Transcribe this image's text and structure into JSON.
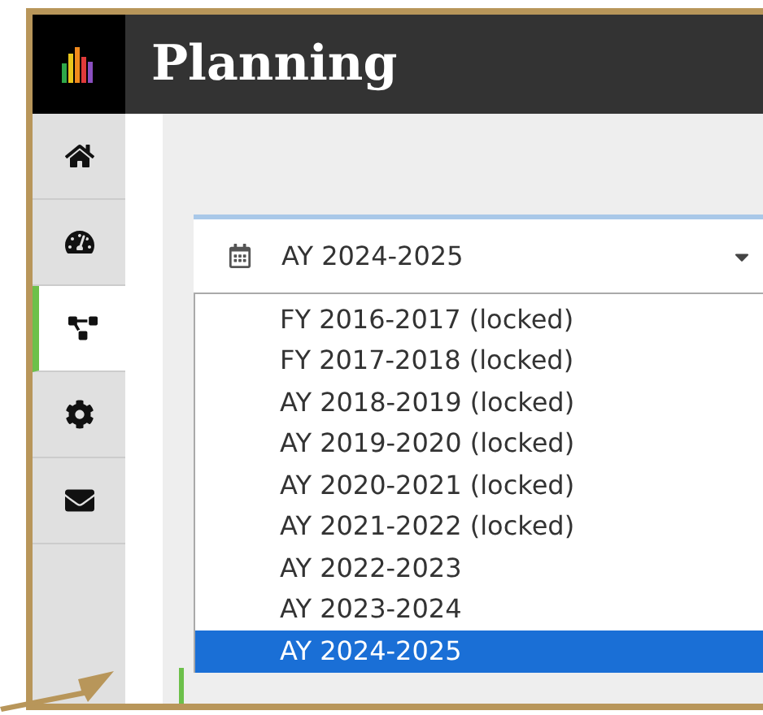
{
  "header": {
    "title": "Planning"
  },
  "nav": [
    {
      "kind": "home",
      "selected": false
    },
    {
      "kind": "gauge",
      "selected": false
    },
    {
      "kind": "diagram",
      "selected": true
    },
    {
      "kind": "gear",
      "selected": false
    },
    {
      "kind": "envelope",
      "selected": false
    }
  ],
  "period_select": {
    "value": "AY 2024-2025",
    "expanded": true
  },
  "options": [
    {
      "label": "FY 2016-2017 (locked)",
      "selected": false
    },
    {
      "label": "FY 2017-2018 (locked)",
      "selected": false
    },
    {
      "label": "AY 2018-2019 (locked)",
      "selected": false
    },
    {
      "label": "AY 2019-2020 (locked)",
      "selected": false
    },
    {
      "label": "AY 2020-2021 (locked)",
      "selected": false
    },
    {
      "label": "AY 2021-2022 (locked)",
      "selected": false
    },
    {
      "label": "AY 2022-2023",
      "selected": false
    },
    {
      "label": "AY 2023-2024",
      "selected": false
    },
    {
      "label": "AY 2024-2025",
      "selected": true
    }
  ]
}
